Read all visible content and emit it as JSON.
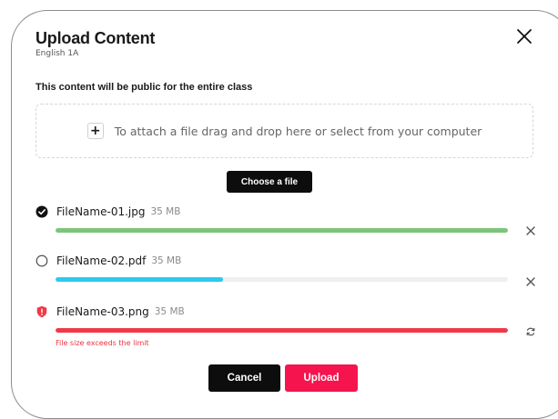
{
  "dialog": {
    "title": "Upload Content",
    "subtitle": "English 1A",
    "notice": "This content will be public for the entire class",
    "close_icon": "close-icon"
  },
  "dropzone": {
    "icon": "plus-icon",
    "icon_glyph": "+",
    "text": "To attach a file drag and drop here or select from your computer"
  },
  "choose_button": {
    "label": "Choose a file"
  },
  "files": [
    {
      "name": "FileName-01.jpg",
      "size": "35 MB",
      "status": "complete",
      "status_icon": "check-circle-icon",
      "progress_percent": 100,
      "bar_color": "#7cc57a",
      "action_icon": "remove-icon"
    },
    {
      "name": "FileName-02.pdf",
      "size": "35 MB",
      "status": "uploading",
      "status_icon": "empty-circle-icon",
      "progress_percent": 37,
      "bar_color": "#2ec9ee",
      "action_icon": "remove-icon"
    },
    {
      "name": "FileName-03.png",
      "size": "35 MB",
      "status": "error",
      "status_icon": "error-shield-icon",
      "progress_percent": 100,
      "bar_color": "#f03a47",
      "action_icon": "retry-icon",
      "error": "File size exceeds the limit"
    }
  ],
  "footer": {
    "cancel_label": "Cancel",
    "upload_label": "Upload"
  },
  "colors": {
    "primary_dark": "#0d0d0d",
    "accent": "#f5144e",
    "success": "#7cc57a",
    "progress": "#2ec9ee",
    "error": "#f03a47"
  }
}
